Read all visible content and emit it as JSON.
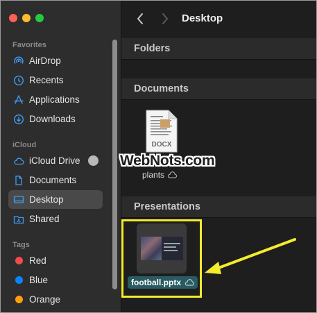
{
  "window": {
    "title": "Desktop"
  },
  "sidebar": {
    "sections": {
      "favorites": "Favorites",
      "icloud": "iCloud",
      "tags": "Tags"
    },
    "favorites": [
      {
        "label": "AirDrop",
        "icon": "airdrop-icon"
      },
      {
        "label": "Recents",
        "icon": "clock-icon"
      },
      {
        "label": "Applications",
        "icon": "applications-icon"
      },
      {
        "label": "Downloads",
        "icon": "download-icon"
      }
    ],
    "icloud": [
      {
        "label": "iCloud Drive",
        "icon": "cloud-icon"
      },
      {
        "label": "Documents",
        "icon": "document-icon"
      },
      {
        "label": "Desktop",
        "icon": "desktop-icon",
        "selected": true
      },
      {
        "label": "Shared",
        "icon": "shared-folder-icon"
      }
    ],
    "tags": [
      {
        "label": "Red",
        "color": "#f34b4a"
      },
      {
        "label": "Blue",
        "color": "#0b84ff"
      },
      {
        "label": "Orange",
        "color": "#ff9f0a"
      }
    ]
  },
  "main": {
    "groups": {
      "folders": "Folders",
      "documents": "Documents",
      "presentations": "Presentations"
    },
    "documents": [
      {
        "name": "plants",
        "type_label": "DOCX"
      }
    ],
    "presentations": [
      {
        "name": "football.pptx"
      }
    ]
  },
  "watermark": "WebNots.com",
  "colors": {
    "highlight": "#f4ec2c",
    "selection_label": "#2a5b63",
    "sidebar_bg": "#2e2d2d",
    "main_bg": "#1e1e1e"
  }
}
